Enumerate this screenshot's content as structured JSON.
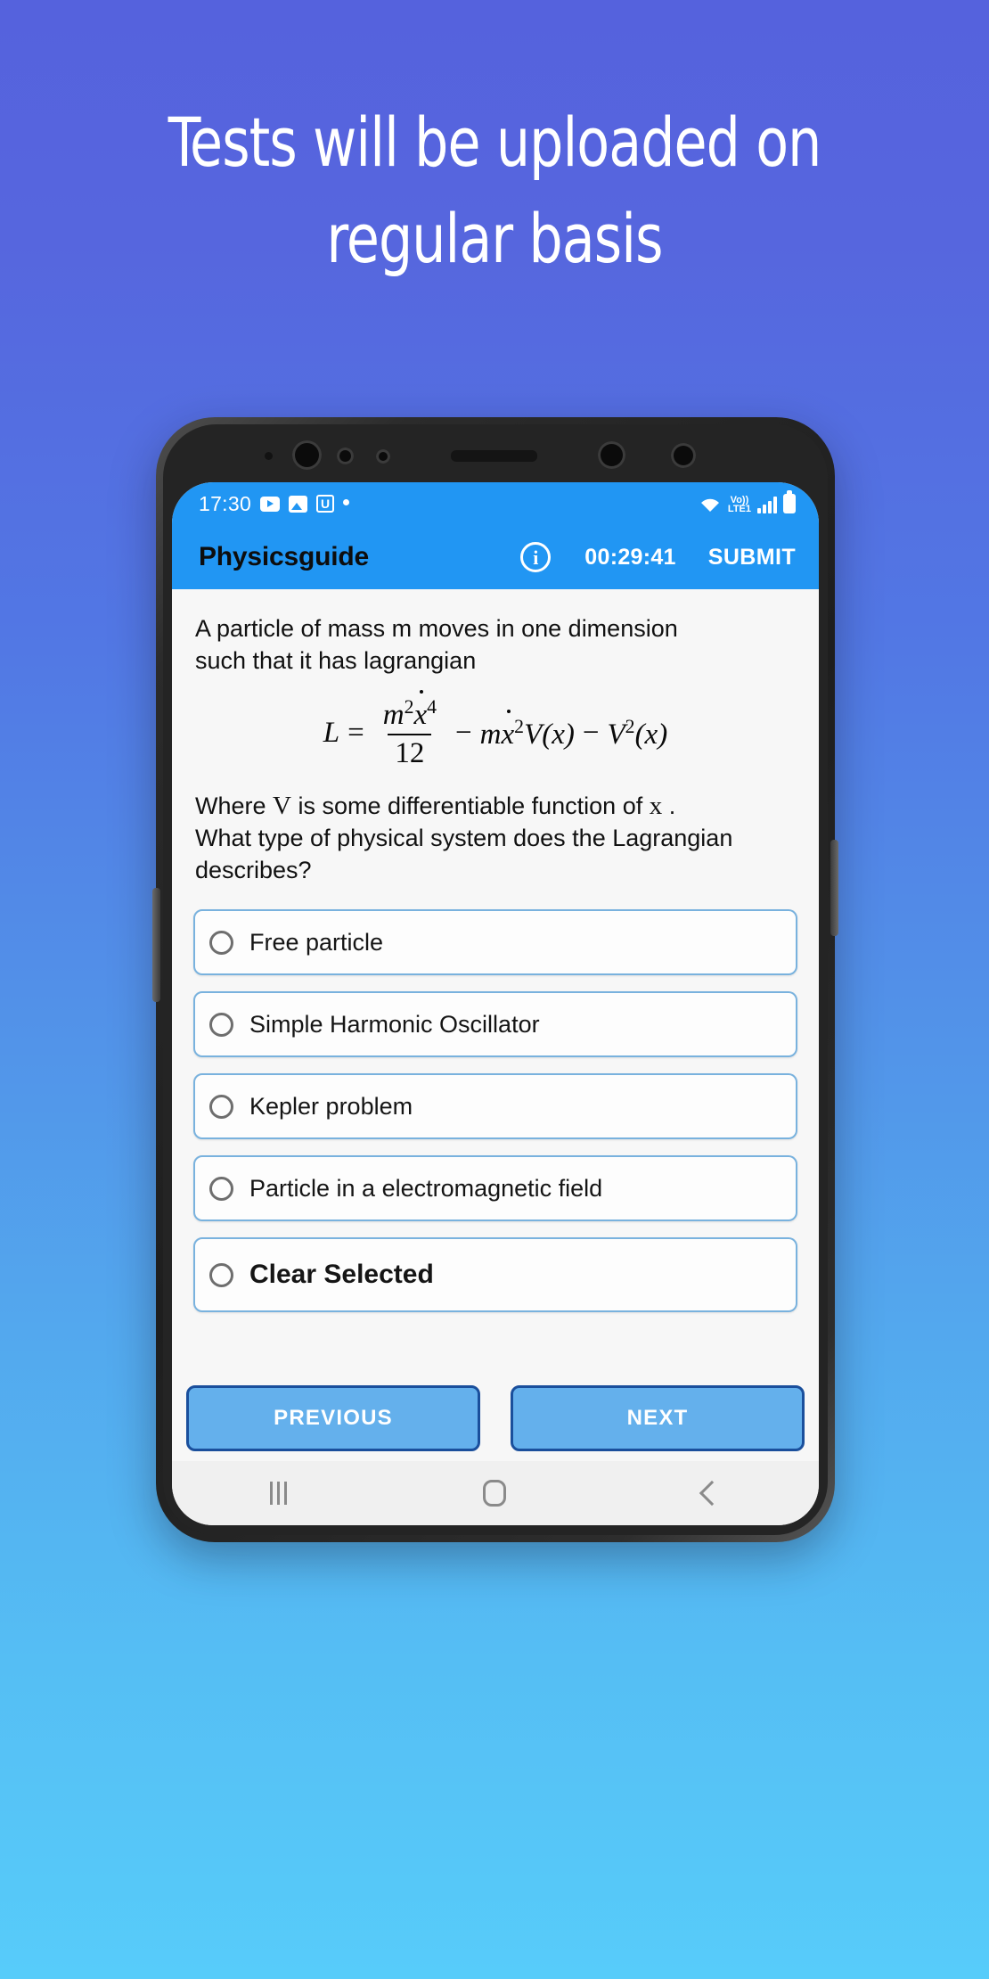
{
  "headline": "Tests will be uploaded on\nregular basis",
  "background": {
    "top_color": "#5562dd",
    "bottom_color": "#57ccfa"
  },
  "phone": {
    "status_bar": {
      "time": "17:30",
      "left_icons": [
        "youtube-icon",
        "image-icon",
        "u-app-icon",
        "dot-icon"
      ],
      "right_icons": [
        "wifi-icon",
        "volte-icon",
        "signal-icon",
        "battery-icon"
      ],
      "volte_label_top": "Vo))",
      "volte_label_bottom": "LTE1",
      "u_glyph": "U",
      "bar_color": "#2196F3"
    },
    "app_bar": {
      "title": "Physicsguide",
      "info_icon_glyph": "i",
      "timer": "00:29:41",
      "submit_label": "SUBMIT"
    },
    "question": {
      "intro": "A particle of mass m moves in one dimension\nsuch that it has lagrangian",
      "equation_plain": "L = m²ẋ⁴/12 − mẋ²V(x) − V²(x)",
      "equation_parts": {
        "lhs": "L",
        "equals": "=",
        "numerator_m": "m",
        "numerator_m_sup": "2",
        "numerator_x": "x",
        "numerator_x_sup": "4",
        "denominator": "12",
        "minus1": "−",
        "term2_m": "m",
        "term2_x": "x",
        "term2_x_sup": "2",
        "term2_V": "V",
        "term2_arg": "(x)",
        "minus2": "−",
        "term3_V": "V",
        "term3_V_sup": "2",
        "term3_arg": "(x)"
      },
      "outro_before_V": "Where ",
      "outro_V": "V",
      "outro_mid": " is some differentiable function of ",
      "outro_x": "x",
      "outro_after": " .",
      "outro_line2": "What type of physical system does the Lagrangian describes?"
    },
    "options": [
      {
        "label": "Free particle",
        "selected": false
      },
      {
        "label": "Simple Harmonic Oscillator",
        "selected": false
      },
      {
        "label": "Kepler problem",
        "selected": false
      },
      {
        "label": "Particle in a electromagnetic field",
        "selected": false
      },
      {
        "label": "Clear Selected",
        "selected": false
      }
    ],
    "footer": {
      "previous_label": "PREVIOUS",
      "next_label": "NEXT"
    },
    "android_nav": {
      "recents": "recents-icon",
      "home": "home-icon",
      "back": "back-icon"
    }
  },
  "colors": {
    "appbar_blue": "#2196F3",
    "option_border": "#79b2de",
    "nav_button_fill": "#64b0ec",
    "nav_button_border": "#1a4f9c"
  }
}
